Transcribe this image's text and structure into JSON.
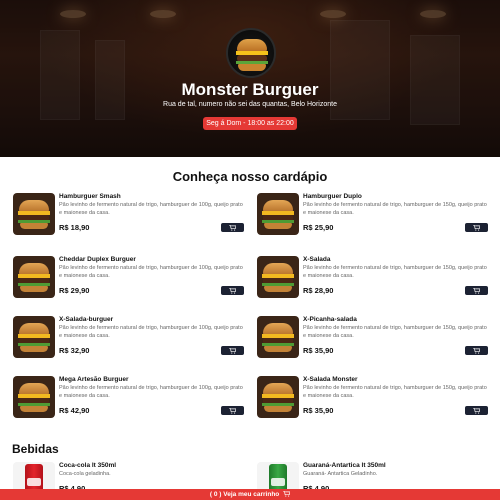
{
  "store": {
    "name": "Monster Burguer",
    "address": "Rua de tal, numero não sei das quantas, Belo Horizonte",
    "hours": "Seg á Dom - 18:00 as 22:00"
  },
  "menu": {
    "title": "Conheça nosso cardápio",
    "items": [
      {
        "name": "Hamburguer Smash",
        "desc": "Pão levinho de fermento natural de trigo, hamburguer de 100g, queijo prato e maionese da casa.",
        "price": "R$ 18,90"
      },
      {
        "name": "Hamburguer Duplo",
        "desc": "Pão levinho de fermento natural de trigo, hamburguer de 150g, queijo prato e maionese da casa.",
        "price": "R$ 25,90"
      },
      {
        "name": "Cheddar Duplex Burguer",
        "desc": "Pão levinho de fermento natural de trigo, hamburguer de 100g, queijo prato e maionese da casa.",
        "price": "R$ 29,90"
      },
      {
        "name": "X-Salada",
        "desc": "Pão levinho de fermento natural de trigo, hamburguer de 150g, queijo prato e maionese da casa.",
        "price": "R$ 28,90"
      },
      {
        "name": "X-Salada-burguer",
        "desc": "Pão levinho de fermento natural de trigo, hamburguer de 100g, queijo prato e maionese da casa.",
        "price": "R$ 32,90"
      },
      {
        "name": "X-Picanha-salada",
        "desc": "Pão levinho de fermento natural de trigo, hamburguer de 150g, queijo prato e maionese da casa.",
        "price": "R$ 35,90"
      },
      {
        "name": "Mega Artesão Burguer",
        "desc": "Pão levinho de fermento natural de trigo, hamburguer de 100g, queijo prato e maionese da casa.",
        "price": "R$ 42,90"
      },
      {
        "name": "X-Salada Monster",
        "desc": "Pão levinho de fermento natural de trigo, hamburguer de 150g, queijo prato e maionese da casa.",
        "price": "R$ 35,90"
      }
    ]
  },
  "drinks": {
    "title": "Bebidas",
    "items": [
      {
        "name": "Coca-cola lt 350ml",
        "desc": "Coca-cola geladinha.",
        "price": "R$ 4,90"
      },
      {
        "name": "Guaraná-Antartica lt 350ml",
        "desc": "Guaraná- Antartica Geladinho.",
        "price": "R$ 4,90"
      }
    ]
  },
  "cart": {
    "label": "( 0 ) Veja meu carrinho"
  },
  "colors": {
    "accent": "#e53935",
    "cart_button": "#1c2233"
  }
}
